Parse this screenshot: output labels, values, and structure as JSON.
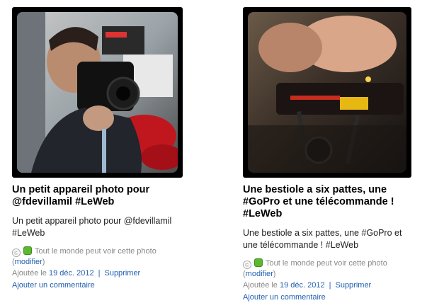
{
  "cards": [
    {
      "title": "Un petit appareil photo pour @fdevillamil #LeWeb",
      "description": "Un petit appareil photo pour @fdevillamil #LeWeb",
      "permission": "Tout le monde peut voir cette photo",
      "modify": "modifier",
      "added_prefix": "Ajoutée le",
      "date": "19 déc. 2012",
      "delete": "Supprimer",
      "add_comment": "Ajouter un commentaire"
    },
    {
      "title": "Une bestiole a six pattes, une #GoPro et une télécommande ! #LeWeb",
      "description": "Une bestiole a six pattes, une #GoPro et une télécommande ! #LeWeb",
      "permission": "Tout le monde peut voir cette photo",
      "modify": "modifier",
      "added_prefix": "Ajoutée le",
      "date": "19 déc. 2012",
      "delete": "Supprimer",
      "add_comment": "Ajouter un commentaire"
    }
  ],
  "icons": {
    "license": "creative-commons-icon",
    "visibility": "public-green-square-icon"
  },
  "colors": {
    "link": "#1f5fb0",
    "muted": "#888888",
    "public": "#5cb82e"
  }
}
